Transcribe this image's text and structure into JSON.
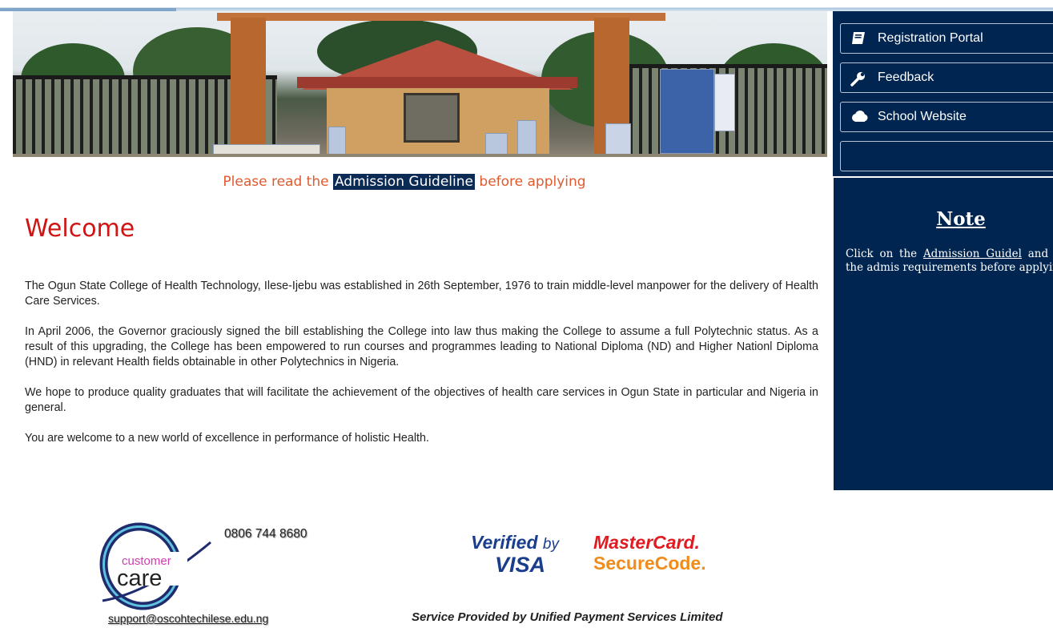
{
  "sidebar": {
    "buttons": [
      {
        "label": "Registration Portal",
        "icon": "book-icon"
      },
      {
        "label": "Feedback",
        "icon": "wrench-icon"
      },
      {
        "label": "School Website",
        "icon": "cloud-icon"
      },
      {
        "label": "",
        "icon": ""
      }
    ],
    "note": {
      "title": "Note",
      "text_before": "Click on the ",
      "link": "Admission Guidel",
      "text_after": " and read the admis requirements before applying"
    }
  },
  "main": {
    "notice": {
      "before": "Please read the ",
      "link": "Admission Guideline",
      "after": " before applying"
    },
    "heading": "Welcome",
    "paragraphs": [
      "The Ogun State College of Health Technology, Ilese-Ijebu was established in 26th September, 1976 to train middle-level manpower for the delivery of Health Care Services.",
      "In April 2006, the Governor graciously signed the bill establishing the College into law thus making the College to assume a full Polytechnic status. As a result of this upgrading, the College has been empowered to run courses and programmes leading to National Diploma (ND) and Higher Nationl Diploma (HND) in relevant Health fields obtainable in other Polytechnics in Nigeria.",
      "We hope to produce quality graduates that will facilitate the achievement of the objectives of health care services in Ogun State in particular and Nigeria in general.",
      "You are welcome to a new world of excellence in performance of holistic Health."
    ]
  },
  "footer": {
    "customer_care": {
      "word1": "customer",
      "word2": "care"
    },
    "phone": "0806 744 8680",
    "email": "support@oscohtechilese.edu.ng",
    "verified_by_visa": {
      "line1": "Verified",
      "by": "by",
      "line2": "VISA"
    },
    "mastercard": {
      "line1": "MasterCard.",
      "line2": "SecureCode."
    },
    "service_text": "Service Provided by Unified Payment Services Limited"
  },
  "colors": {
    "sidebar_bg": "#002551",
    "welcome_red": "#d01313",
    "notice_orange": "#e05a2e",
    "visa_blue": "#1a3e8c",
    "mastercard_red": "#e01b22",
    "mastercard_orange": "#f08c1c"
  }
}
